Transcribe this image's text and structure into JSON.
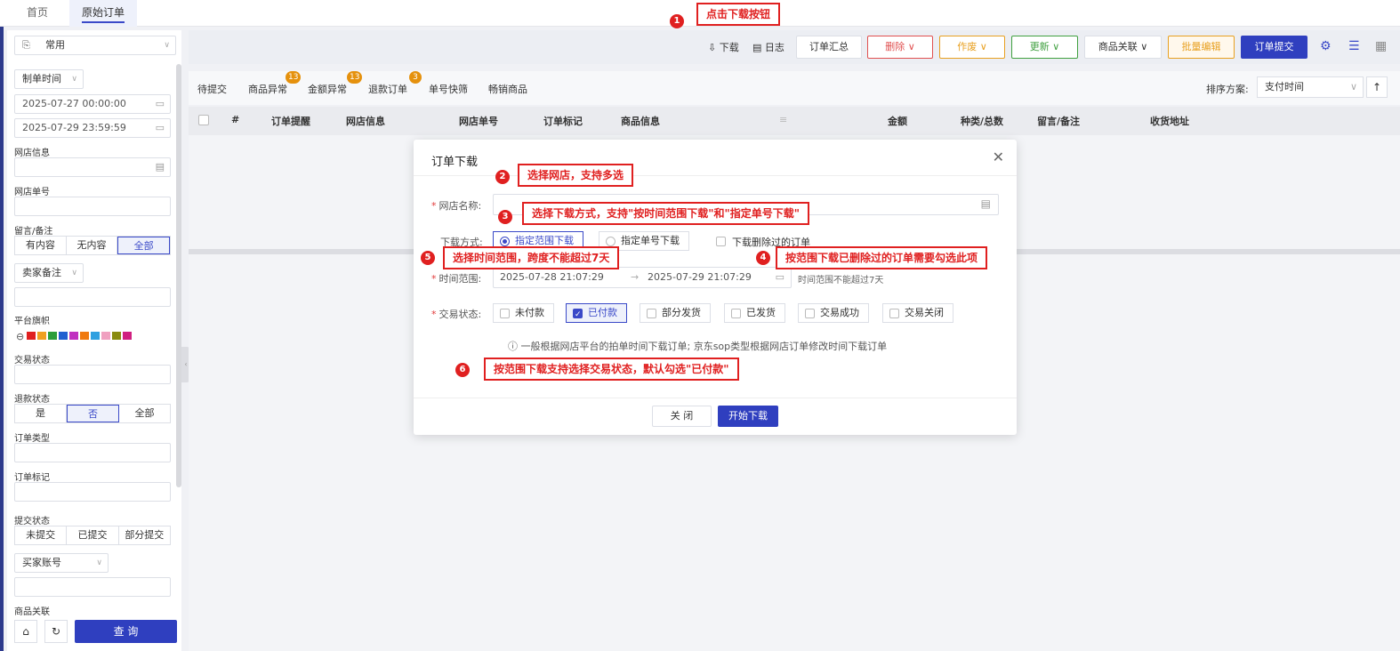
{
  "top_tabs": [
    "首页",
    "原始订单"
  ],
  "sidebar": {
    "preset": "常用",
    "date_type": "制单时间",
    "date_start": "2025-07-27 00:00:00",
    "date_end": "2025-07-29 23:59:59",
    "shop_label": "网店信息",
    "order_no_label": "网店单号",
    "memo_label": "留言/备注",
    "memo_options": [
      "有内容",
      "无内容",
      "全部"
    ],
    "seller_memo": "卖家备注",
    "flag_label": "平台旗帜",
    "flag_colors": [
      "#e02020",
      "#f0a020",
      "#2a9d3a",
      "#2060d0",
      "#c030c0",
      "#f07a10",
      "#30a0e0",
      "#f0a0c0",
      "#8a8a10",
      "#d02080"
    ],
    "trade_status_label": "交易状态",
    "refund_label": "退款状态",
    "refund_options": [
      "是",
      "否",
      "全部"
    ],
    "order_type_label": "订单类型",
    "order_mark_label": "订单标记",
    "submit_label": "提交状态",
    "submit_options": [
      "未提交",
      "已提交",
      "部分提交"
    ],
    "buyer_account": "买家账号",
    "product_link_label": "商品关联",
    "query_button": "查 询"
  },
  "toolbar": {
    "download": "下载",
    "log": "日志",
    "summary": "订单汇总",
    "delete": "删除",
    "void": "作废",
    "update": "更新",
    "product_link": "商品关联",
    "batch_edit": "批量编辑",
    "submit": "订单提交"
  },
  "tabs": {
    "items": [
      "待提交",
      "商品异常",
      "金额异常",
      "退款订单",
      "单号快筛",
      "畅销商品"
    ],
    "badges": [
      "13",
      "13",
      "3"
    ],
    "sort_label": "排序方案:",
    "sort_value": "支付时间"
  },
  "table_headers": [
    "#",
    "订单提醒",
    "网店信息",
    "网店单号",
    "订单标记",
    "商品信息",
    "金额",
    "种类/总数",
    "留言/备注",
    "收货地址"
  ],
  "modal": {
    "title": "订单下载",
    "shop_name_label": "网店名称:",
    "download_mode_label": "下载方式:",
    "mode_range": "指定范围下载",
    "mode_number": "指定单号下载",
    "include_deleted": "下载删除过的订单",
    "time_range_label": "时间范围:",
    "time_start": "2025-07-28 21:07:29",
    "time_sep": "→",
    "time_end": "2025-07-29 21:07:29",
    "time_hint": "时间范围不能超过7天",
    "trade_status_label": "交易状态:",
    "statuses": [
      "未付款",
      "已付款",
      "部分发货",
      "已发货",
      "交易成功",
      "交易关闭"
    ],
    "info_text": "一般根据网店平台的拍单时间下载订单; 京东sop类型根据网店订单修改时间下载订单",
    "close_button": "关 闭",
    "start_button": "开始下载"
  },
  "annotations": [
    {
      "num": "1",
      "text": "点击下载按钮"
    },
    {
      "num": "2",
      "text": "选择网店，支持多选"
    },
    {
      "num": "3",
      "text": "选择下载方式，支持\"按时间范围下载\"和\"指定单号下载\""
    },
    {
      "num": "4",
      "text": "按范围下载已删除过的订单需要勾选此项"
    },
    {
      "num": "5",
      "text": "选择时间范围，跨度不能超过7天"
    },
    {
      "num": "6",
      "text": "按范围下载支持选择交易状态，默认勾选\"已付款\""
    }
  ]
}
